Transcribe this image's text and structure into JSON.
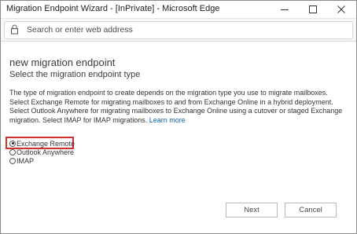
{
  "window": {
    "title": "Migration Endpoint Wizard - [InPrivate] - Microsoft Edge"
  },
  "addressbar": {
    "placeholder": "Search or enter web address"
  },
  "page": {
    "title": "new migration endpoint",
    "subtitle": "Select the migration endpoint type",
    "description": "The type of migration endpoint to create depends on the migration type you use to migrate mailboxes. Select Exchange Remote for migrating mailboxes to and from Exchange Online in a hybrid deployment. Select Outlook Anywhere for migrating mailboxes to Exchange Online using a cutover or staged Exchange migration. Select IMAP for IMAP migrations.",
    "learn_more": "Learn more"
  },
  "options": [
    {
      "label": "Exchange Remote",
      "selected": true
    },
    {
      "label": "Outlook Anywhere",
      "selected": false
    },
    {
      "label": "IMAP",
      "selected": false
    }
  ],
  "buttons": {
    "next": "Next",
    "cancel": "Cancel"
  },
  "colors": {
    "highlight": "#d0312d",
    "link": "#0b5ea8"
  },
  "icons": [
    "minimize-icon",
    "maximize-icon",
    "close-icon",
    "lock-icon"
  ]
}
